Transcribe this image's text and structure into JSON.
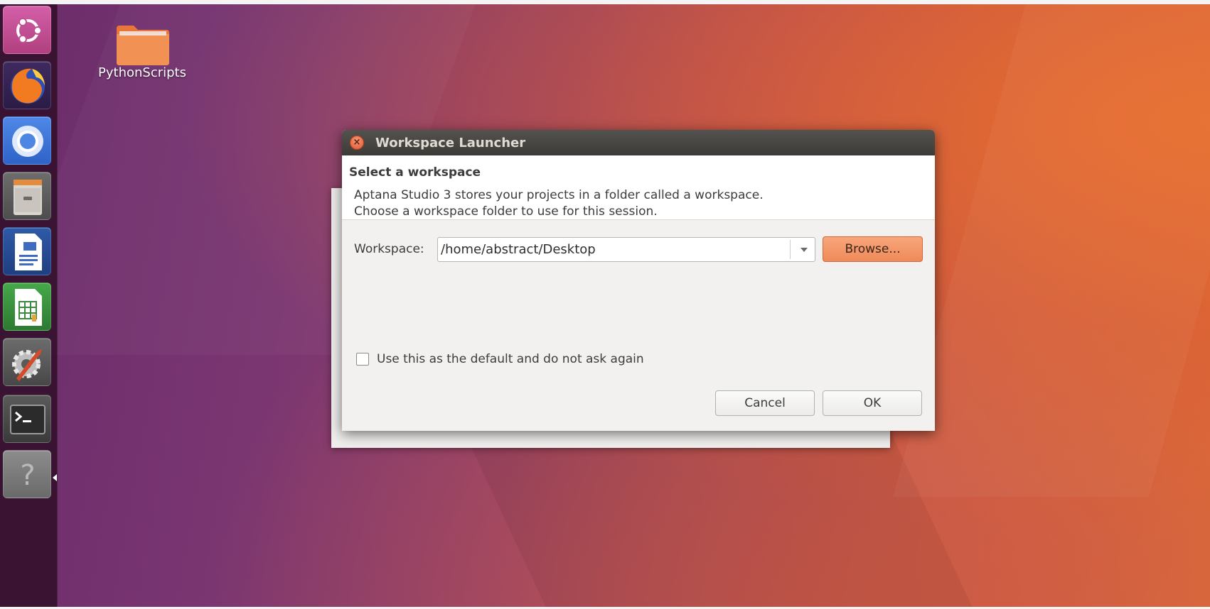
{
  "desktop": {
    "icons": [
      {
        "label": "PythonScripts",
        "icon": "folder-icon"
      }
    ]
  },
  "launcher": {
    "items": [
      {
        "name": "dash-home",
        "icon": "ubuntu-logo-icon"
      },
      {
        "name": "firefox",
        "icon": "firefox-icon"
      },
      {
        "name": "chromium",
        "icon": "chromium-icon"
      },
      {
        "name": "files",
        "icon": "file-cabinet-icon"
      },
      {
        "name": "libreoffice-writer",
        "icon": "document-icon"
      },
      {
        "name": "libreoffice-calc",
        "icon": "spreadsheet-icon"
      },
      {
        "name": "system-settings",
        "icon": "gear-wrench-icon"
      },
      {
        "name": "terminal",
        "icon": "terminal-icon"
      },
      {
        "name": "help",
        "icon": "question-mark-icon",
        "glyph": "?"
      }
    ]
  },
  "dialog": {
    "title": "Workspace Launcher",
    "close_glyph": "×",
    "header": {
      "title": "Select a workspace",
      "description_line1": "Aptana Studio 3 stores your projects in a folder called a workspace.",
      "description_line2": "Choose a workspace folder to use for this session."
    },
    "workspace": {
      "label": "Workspace:",
      "value": "/home/abstract/Desktop"
    },
    "browse_label": "Browse...",
    "checkbox": {
      "label": "Use this as the default and do not ask again",
      "checked": false
    },
    "buttons": {
      "cancel": "Cancel",
      "ok": "OK"
    }
  },
  "colors": {
    "accent": "#ef8a5a",
    "titlebar": "#3c3b37",
    "close": "#e0552d"
  }
}
